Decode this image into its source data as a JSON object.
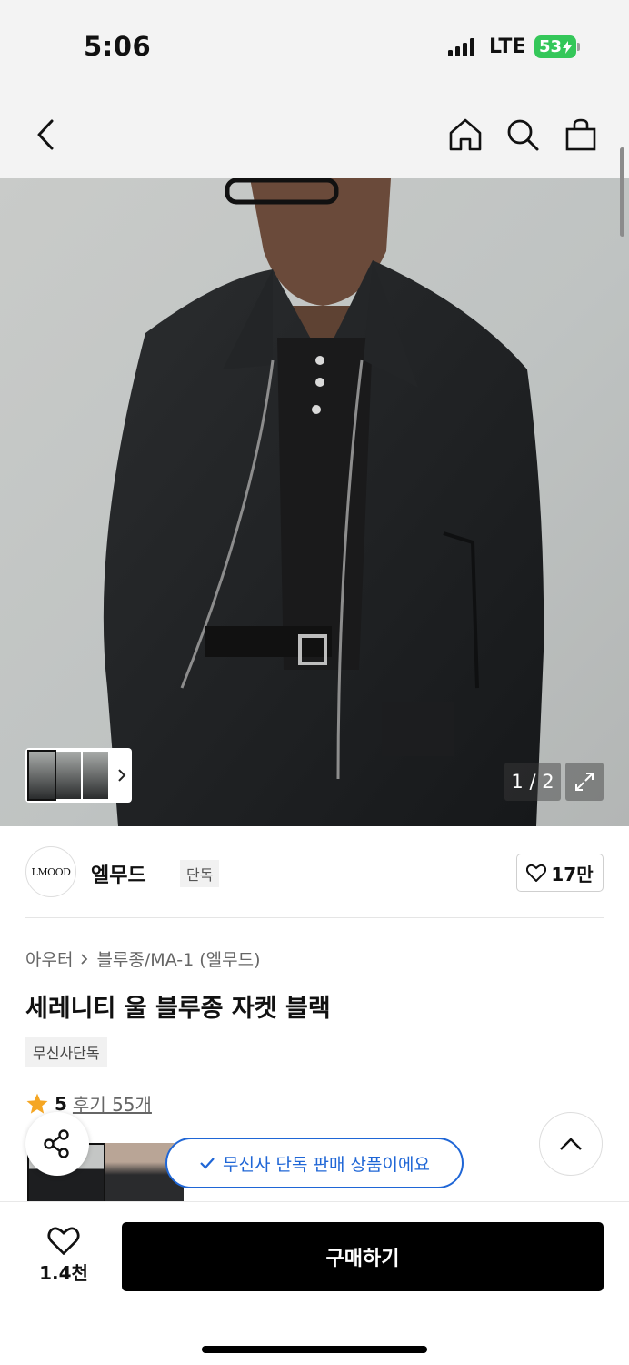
{
  "status_bar": {
    "time": "5:06",
    "network": "LTE",
    "battery": "53"
  },
  "nav": {
    "icons": [
      "back-icon",
      "home-icon",
      "search-icon",
      "shopping-bag-icon"
    ]
  },
  "hero": {
    "counter": "1 / 2",
    "image_subject": "model wearing black wool blouson jacket"
  },
  "brand": {
    "logo_text": "LMOOD",
    "name": "엘무드",
    "tag": "단독",
    "like_count": "17만"
  },
  "product": {
    "breadcrumb": [
      "아우터",
      "블루종/MA-1 (엘무드)"
    ],
    "title": "세레니티 울 블루종 자켓 블랙",
    "badge": "무신사단독",
    "rating": "5",
    "reviews": "후기 55개"
  },
  "notice": "무신사 단독 판매 상품이에요",
  "bottom": {
    "wish_count": "1.4천",
    "buy_label": "구매하기"
  },
  "colors": {
    "accent_blue": "#1f66d6",
    "star": "#f5a623",
    "battery_green": "#34c759"
  }
}
